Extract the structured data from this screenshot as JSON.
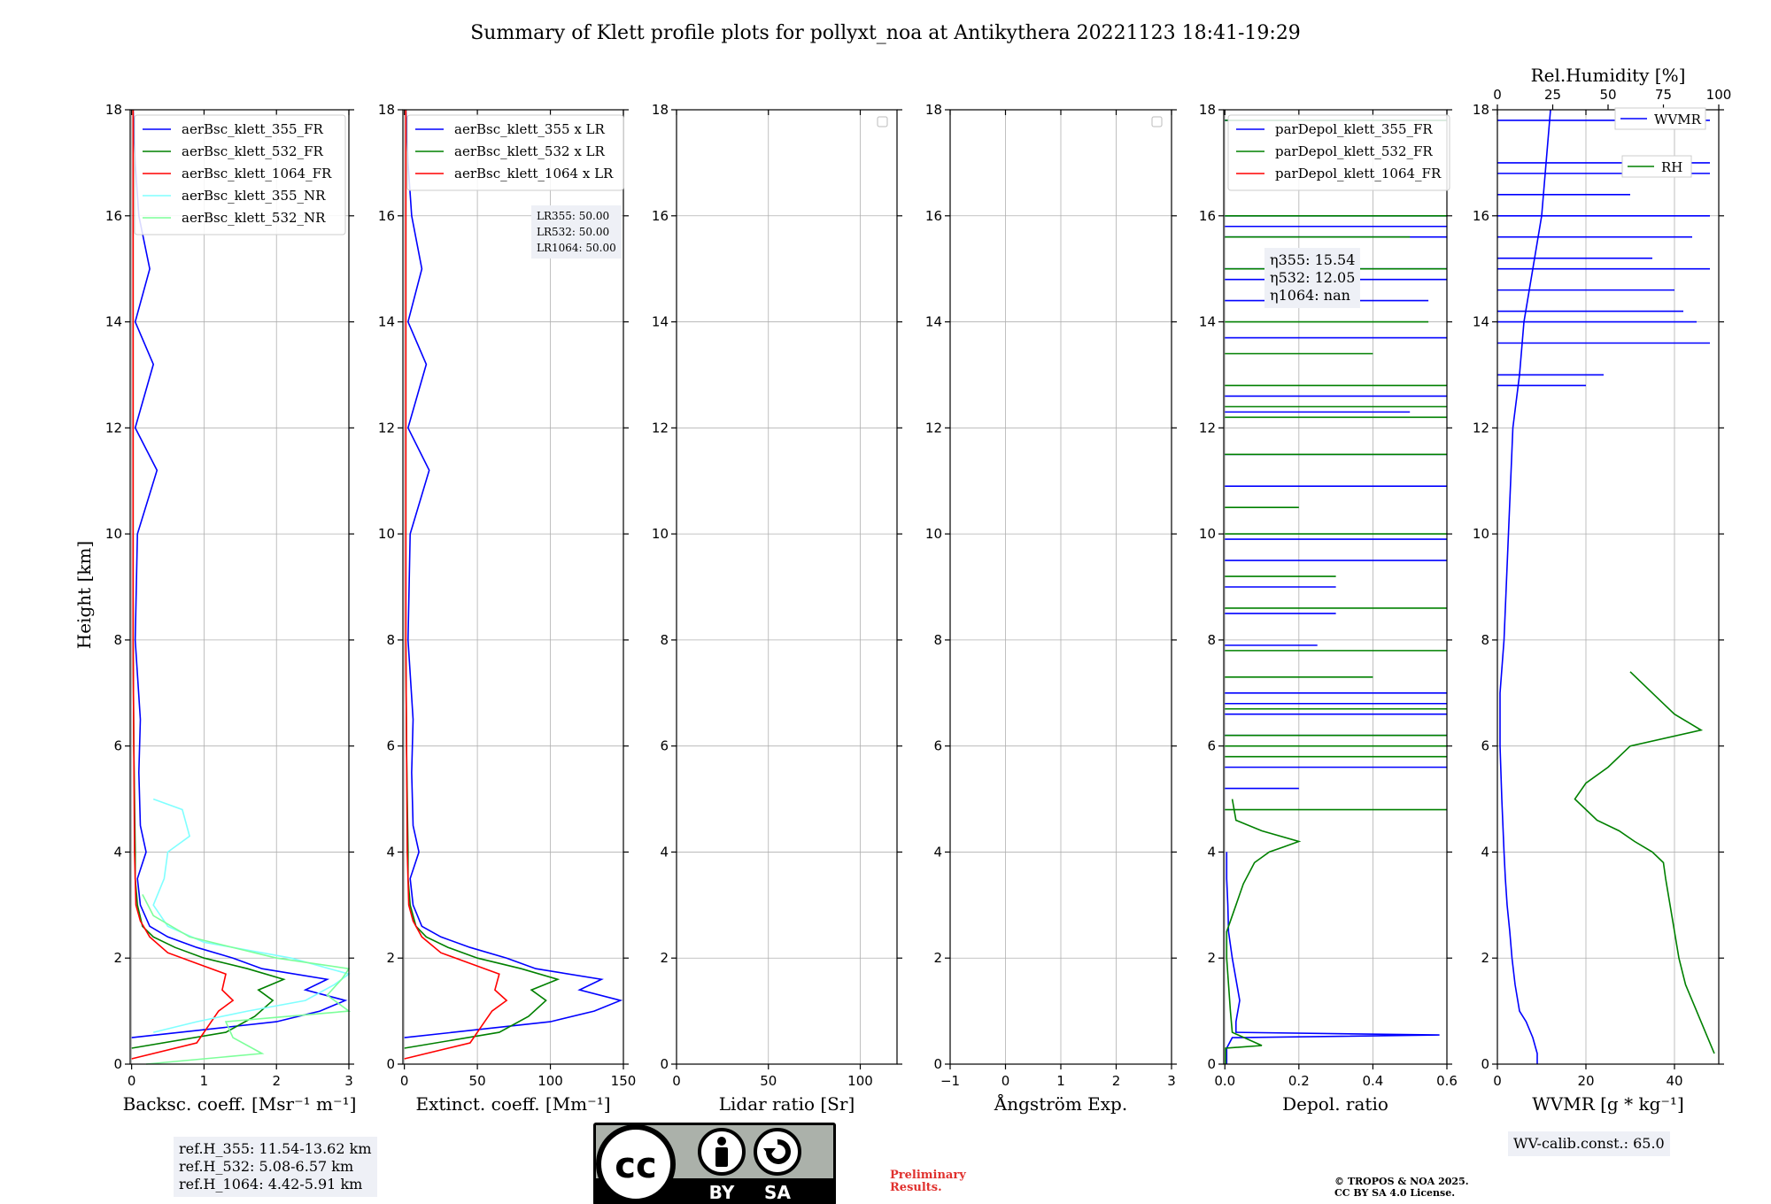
{
  "title": "Summary of Klett profile plots for pollyxt_noa at Antikythera 20221123 18:41-19:29",
  "ylabel": "Height [km]",
  "ylim": [
    0,
    18
  ],
  "yticks": [
    0,
    2,
    4,
    6,
    8,
    10,
    12,
    14,
    16,
    18
  ],
  "panels": [
    {
      "id": "backscatter",
      "xlabel": "Backsc. coeff. [Msr⁻¹ m⁻¹]",
      "xlim": [
        -0.02,
        3
      ],
      "xticks": [
        0,
        1,
        2,
        3
      ],
      "legend_placement": "top-left",
      "series": [
        {
          "name": "aerBsc_klett_355_FR",
          "color": "#0000ff"
        },
        {
          "name": "aerBsc_klett_532_FR",
          "color": "#008000"
        },
        {
          "name": "aerBsc_klett_1064_FR",
          "color": "#ff0000"
        },
        {
          "name": "aerBsc_klett_355_NR",
          "color": "#80ffff"
        },
        {
          "name": "aerBsc_klett_532_NR",
          "color": "#7dff9a"
        }
      ]
    },
    {
      "id": "extinction",
      "xlabel": "Extinct. coeff. [Mm⁻¹]",
      "xlim": [
        -1,
        150
      ],
      "xticks": [
        0,
        50,
        100,
        150
      ],
      "legend_placement": "top-left",
      "series": [
        {
          "name": "aerBsc_klett_355 x LR",
          "color": "#0000ff"
        },
        {
          "name": "aerBsc_klett_532 x LR",
          "color": "#008000"
        },
        {
          "name": "aerBsc_klett_1064 x LR",
          "color": "#ff0000"
        }
      ]
    },
    {
      "id": "lidar-ratio",
      "xlabel": "Lidar ratio [Sr]",
      "xlim": [
        0,
        120
      ],
      "xticks": [
        0,
        50,
        100
      ],
      "series": []
    },
    {
      "id": "angstrom",
      "xlabel": "Ångström Exp.",
      "xlim": [
        -1,
        3
      ],
      "xticks": [
        -1,
        0,
        1,
        2,
        3
      ],
      "series": []
    },
    {
      "id": "depol",
      "xlabel": "Depol. ratio",
      "xlim": [
        -0.003,
        0.6
      ],
      "xticks": [
        0.0,
        0.2,
        0.4,
        0.6
      ],
      "xtick_labels": [
        "0.0",
        "0.2",
        "0.4",
        "0.6"
      ],
      "legend_placement": "top-left",
      "series": [
        {
          "name": "parDepol_klett_355_FR",
          "color": "#0000ff"
        },
        {
          "name": "parDepol_klett_532_FR",
          "color": "#008000"
        },
        {
          "name": "parDepol_klett_1064_FR",
          "color": "#ff0000"
        }
      ]
    },
    {
      "id": "wvmr",
      "xlabel": "WVMR [g * kg⁻¹]",
      "xlim": [
        0,
        50
      ],
      "xticks": [
        0,
        20,
        40
      ],
      "top_xlabel": "Rel.Humidity [%]",
      "top_xlim": [
        0,
        100
      ],
      "top_xticks": [
        0,
        25,
        50,
        75,
        100
      ],
      "series": [
        {
          "name": "WVMR",
          "color": "#0000ff"
        },
        {
          "name": "RH",
          "color": "#008000"
        }
      ]
    }
  ],
  "chart_data": [
    {
      "type": "line",
      "xlabel": "Backsc. coeff. [Msr⁻¹ m⁻¹]",
      "ylabel": "Height [km]",
      "xlim": [
        -0.02,
        3
      ],
      "ylim": [
        0,
        18
      ],
      "series": [
        {
          "name": "aerBsc_klett_355_FR",
          "height_km": [
            0.5,
            0.8,
            1.0,
            1.2,
            1.4,
            1.6,
            1.8,
            2.0,
            2.2,
            2.4,
            2.6,
            3.0,
            3.5,
            4.0,
            4.5,
            5.5,
            6.5,
            8.0,
            10.0,
            11.2,
            12.0,
            13.2,
            14.0,
            15.0,
            16.0,
            17.0,
            18.0
          ],
          "value": [
            0.0,
            2.0,
            2.6,
            2.95,
            2.4,
            2.7,
            1.8,
            1.4,
            0.9,
            0.5,
            0.25,
            0.12,
            0.08,
            0.2,
            0.12,
            0.1,
            0.12,
            0.05,
            0.08,
            0.35,
            0.05,
            0.3,
            0.05,
            0.25,
            0.1,
            0.05,
            0.02
          ]
        },
        {
          "name": "aerBsc_klett_532_FR",
          "height_km": [
            0.3,
            0.6,
            0.9,
            1.2,
            1.4,
            1.6,
            1.8,
            2.0,
            2.2,
            2.4,
            2.6,
            3.0,
            3.5,
            4.0,
            5.0,
            6.0,
            8.0,
            10.0,
            12.0,
            14.0,
            16.0,
            18.0
          ],
          "value": [
            0.0,
            1.3,
            1.7,
            1.95,
            1.75,
            2.1,
            1.6,
            1.0,
            0.6,
            0.3,
            0.15,
            0.08,
            0.05,
            0.05,
            0.04,
            0.03,
            0.02,
            0.02,
            0.02,
            0.02,
            0.02,
            0.02
          ]
        },
        {
          "name": "aerBsc_klett_1064_FR",
          "height_km": [
            0.1,
            0.4,
            0.8,
            1.0,
            1.2,
            1.4,
            1.7,
            1.9,
            2.1,
            2.4,
            2.7,
            3.0,
            4.0,
            6.0,
            8.0,
            10.0,
            14.0,
            18.0
          ],
          "value": [
            0.0,
            0.9,
            1.1,
            1.2,
            1.4,
            1.25,
            1.3,
            0.9,
            0.5,
            0.25,
            0.12,
            0.06,
            0.04,
            0.03,
            0.02,
            0.02,
            0.02,
            0.02
          ]
        },
        {
          "name": "aerBsc_klett_355_NR",
          "height_km": [
            0.6,
            0.8,
            1.0,
            1.2,
            1.5,
            1.7,
            2.0,
            2.3,
            2.6,
            3.0,
            3.5,
            4.0,
            4.3,
            4.8,
            5.0
          ],
          "value": [
            0.3,
            0.9,
            1.6,
            2.4,
            2.8,
            3.0,
            2.2,
            1.0,
            0.5,
            0.3,
            0.45,
            0.5,
            0.8,
            0.7,
            0.3
          ]
        },
        {
          "name": "aerBsc_klett_532_NR",
          "height_km": [
            0.0,
            0.2,
            0.5,
            0.8,
            1.0,
            1.3,
            1.6,
            1.8,
            2.0,
            2.4,
            2.8,
            3.2
          ],
          "value": [
            0.2,
            1.8,
            1.4,
            1.3,
            3.0,
            2.7,
            2.9,
            3.0,
            2.0,
            0.8,
            0.3,
            0.15
          ]
        }
      ]
    },
    {
      "type": "line",
      "xlabel": "Extinct. coeff. [Mm⁻¹]",
      "xlim": [
        -1,
        150
      ],
      "ylim": [
        0,
        18
      ],
      "series": [
        {
          "name": "aerBsc_klett_355 x LR",
          "height_km": [
            0.5,
            0.8,
            1.0,
            1.2,
            1.4,
            1.6,
            1.8,
            2.0,
            2.2,
            2.4,
            2.6,
            3.0,
            3.5,
            4.0,
            4.5,
            5.5,
            6.5,
            8.0,
            10.0,
            11.2,
            12.0,
            13.2,
            14.0,
            15.0,
            16.0,
            17.0,
            18.0
          ],
          "value": [
            0.0,
            100,
            130,
            148,
            120,
            135,
            90,
            70,
            45,
            25,
            12,
            6,
            4,
            10,
            6,
            5,
            6,
            2.5,
            4,
            17,
            2.5,
            15,
            2.5,
            12,
            5,
            2.5,
            1
          ]
        },
        {
          "name": "aerBsc_klett_532 x LR",
          "height_km": [
            0.3,
            0.6,
            0.9,
            1.2,
            1.4,
            1.6,
            1.8,
            2.0,
            2.2,
            2.4,
            2.6,
            3.0,
            3.5,
            4.0,
            5.0,
            6.0,
            8.0,
            10.0,
            12.0,
            14.0,
            16.0,
            18.0
          ],
          "value": [
            0.0,
            65,
            85,
            97,
            87,
            105,
            80,
            50,
            30,
            15,
            8,
            4,
            2.5,
            2.5,
            2,
            1.5,
            1,
            1,
            1,
            1,
            1,
            1
          ]
        },
        {
          "name": "aerBsc_klett_1064 x LR",
          "height_km": [
            0.1,
            0.4,
            0.8,
            1.0,
            1.2,
            1.4,
            1.7,
            1.9,
            2.1,
            2.4,
            2.7,
            3.0,
            4.0,
            6.0,
            8.0,
            10.0,
            14.0,
            18.0
          ],
          "value": [
            0.0,
            45,
            55,
            60,
            70,
            62,
            65,
            45,
            25,
            12,
            6,
            3,
            2,
            1.5,
            1,
            1,
            1,
            1
          ]
        }
      ]
    },
    {
      "type": "line",
      "xlabel": "Lidar ratio [Sr]",
      "xlim": [
        0,
        120
      ],
      "ylim": [
        0,
        18
      ],
      "series": []
    },
    {
      "type": "line",
      "xlabel": "Ångström Exp.",
      "xlim": [
        -1,
        3
      ],
      "ylim": [
        0,
        18
      ],
      "series": []
    },
    {
      "type": "line",
      "xlabel": "Depol. ratio",
      "xlim": [
        -0.003,
        0.6
      ],
      "ylim": [
        0,
        18
      ],
      "series": [
        {
          "name": "parDepol_klett_355_FR",
          "height_km": [
            0.0,
            0.3,
            0.5,
            0.55,
            0.6,
            0.8,
            1.0,
            1.2,
            1.4,
            1.6,
            2.0,
            2.5,
            3.0,
            3.5,
            4.0
          ],
          "value": [
            0.005,
            0.005,
            0.02,
            0.58,
            0.03,
            0.03,
            0.035,
            0.04,
            0.035,
            0.03,
            0.02,
            0.01,
            0.008,
            0.005,
            0.005
          ],
          "spikes_height_km": [
            5.2,
            5.6,
            6.2,
            6.6,
            6.8,
            7.0,
            7.9,
            8.5,
            9.0,
            9.5,
            9.9,
            10.9,
            11.5,
            12.3,
            12.6,
            13.7,
            14.4,
            14.8,
            15.0,
            15.6,
            15.8,
            16.0,
            17.8
          ],
          "spikes_value": [
            0.2,
            0.6,
            0.6,
            0.6,
            0.6,
            0.6,
            0.25,
            0.3,
            0.3,
            0.6,
            0.6,
            0.6,
            0.6,
            0.5,
            0.6,
            0.6,
            0.55,
            0.6,
            0.6,
            0.6,
            0.6,
            0.6,
            0.6
          ]
        },
        {
          "name": "parDepol_klett_532_FR",
          "height_km": [
            0.0,
            0.3,
            0.35,
            0.6,
            1.0,
            1.5,
            2.0,
            2.5,
            3.0,
            3.4,
            3.8,
            4.0,
            4.1,
            4.2,
            4.4,
            4.6,
            5.0
          ],
          "value": [
            0.002,
            0.002,
            0.1,
            0.02,
            0.015,
            0.01,
            0.005,
            0.005,
            0.03,
            0.05,
            0.08,
            0.12,
            0.16,
            0.2,
            0.1,
            0.03,
            0.02
          ],
          "spikes_height_km": [
            4.8,
            5.8,
            6.0,
            6.2,
            6.7,
            7.3,
            7.8,
            8.6,
            9.2,
            10.0,
            10.5,
            11.5,
            12.2,
            12.4,
            12.8,
            13.4,
            14.0,
            15.0,
            15.6,
            16.0,
            17.8
          ],
          "spikes_value": [
            0.6,
            0.6,
            0.6,
            0.6,
            0.6,
            0.4,
            0.6,
            0.6,
            0.3,
            0.6,
            0.2,
            0.6,
            0.6,
            0.6,
            0.6,
            0.4,
            0.55,
            0.6,
            0.5,
            0.6,
            0.6
          ]
        },
        {
          "name": "parDepol_klett_1064_FR",
          "height_km": [],
          "value": []
        }
      ]
    },
    {
      "type": "line",
      "xlabel": "WVMR [g * kg⁻¹]",
      "xlim": [
        0,
        50
      ],
      "ylim": [
        0,
        18
      ],
      "series": [
        {
          "name": "WVMR",
          "height_km": [
            0.0,
            0.2,
            0.5,
            0.8,
            1.0,
            1.5,
            2.0,
            2.5,
            3.0,
            3.5,
            4.0,
            5.0,
            6.0,
            7.0,
            8.0,
            9.0,
            10.0,
            11.0,
            12.0,
            13.0,
            14.0,
            15.0,
            16.0,
            17.0,
            18.0
          ],
          "value": [
            9,
            9,
            8,
            6.5,
            5,
            4,
            3.3,
            2.8,
            2.2,
            1.8,
            1.5,
            1.0,
            0.6,
            0.6,
            1.5,
            2,
            2.5,
            3,
            3.5,
            5,
            6,
            8,
            10,
            11,
            12
          ],
          "spikes_height_km": [
            12.8,
            13.0,
            13.6,
            14.0,
            14.2,
            14.6,
            15.0,
            15.2,
            15.6,
            16.0,
            16.4,
            16.8,
            17.0,
            17.8
          ],
          "spikes_value": [
            20,
            24,
            48,
            45,
            42,
            40,
            48,
            35,
            44,
            48,
            30,
            48,
            48,
            48
          ]
        },
        {
          "name": "RH",
          "rh_percent": [
            98,
            95,
            90,
            85,
            82,
            80,
            78,
            76,
            75,
            70,
            62,
            55,
            45,
            40,
            35,
            40,
            50,
            60,
            92,
            80,
            75,
            70,
            65,
            60
          ],
          "height_km": [
            0.2,
            0.5,
            1.0,
            1.5,
            2.0,
            2.5,
            3.0,
            3.5,
            3.8,
            4.0,
            4.2,
            4.4,
            4.6,
            4.8,
            5.0,
            5.3,
            5.6,
            6.0,
            6.3,
            6.6,
            6.8,
            7.0,
            7.2,
            7.4
          ]
        }
      ]
    }
  ],
  "annotations": {
    "lr": [
      "LR355: 50.00",
      "LR532: 50.00",
      "LR1064: 50.00"
    ],
    "eta": [
      "η355: 15.54",
      "η532: 12.05",
      "η1064: nan"
    ],
    "ref_heights": [
      "ref.H_355: 11.54-13.62 km",
      "ref.H_532: 5.08-6.57 km",
      "ref.H_1064: 4.42-5.91 km"
    ],
    "wv_calib": "WV-calib.const.: 65.0",
    "preliminary": [
      "Preliminary",
      "Results."
    ],
    "copyright": [
      "© TROPOS & NOA 2025.",
      "CC BY SA 4.0 License."
    ]
  },
  "license_badge": {
    "by": "BY",
    "sa": "SA",
    "cc": "cc"
  }
}
